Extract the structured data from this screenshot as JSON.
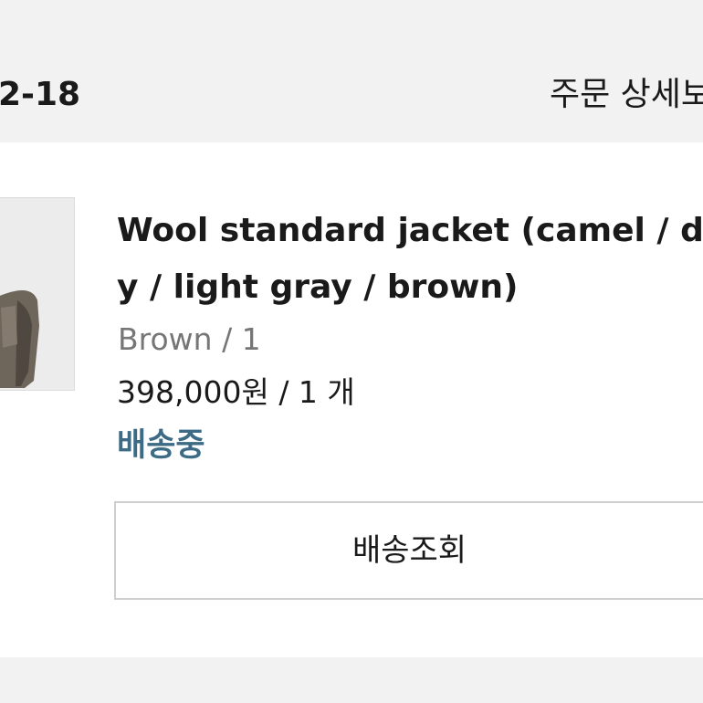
{
  "header": {
    "order_date": "2-18",
    "order_detail_label": "주문 상세보"
  },
  "product": {
    "image_icon": "product-photo",
    "title_line1": "Wool standard jacket (camel / da",
    "title_line2": "y / light gray / brown)",
    "option": "Brown / 1",
    "price_qty": "398,000원 / 1 개",
    "status": "배송중",
    "colors": {
      "status": "#3d6b86",
      "option": "#767676"
    }
  },
  "actions": {
    "track_label": "배송조회"
  }
}
